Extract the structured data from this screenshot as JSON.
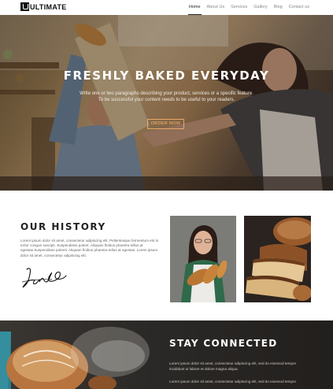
{
  "header": {
    "logo_text": "ULTIMATE",
    "nav": [
      {
        "label": "Home",
        "active": true
      },
      {
        "label": "About Us",
        "active": false
      },
      {
        "label": "Services",
        "active": false
      },
      {
        "label": "Gallery",
        "active": false
      },
      {
        "label": "Blog",
        "active": false
      },
      {
        "label": "Contact us",
        "active": false
      }
    ]
  },
  "hero": {
    "title": "FRESHLY BAKED EVERYDAY",
    "subtitle_line1": "Write one or two paragraphs describing your product, services or a specific feature.",
    "subtitle_line2": "To be successful your content needs to be useful to your readers.",
    "button_label": "ORDER NOW"
  },
  "history": {
    "title": "OUR HISTORY",
    "paragraph": "Lorem ipsum dolor sit amet, consectetur adipiscing elit. Pellentesque fermentum est in tortor congue suscipit. Suspendisse potent. Aliquam finibus pharetra tellus at egestas.Suspendisse potenti. Aliquam finibus pharetra tellus at egestas. Lorem ipsum dolor sit amet, consectetur adipiscing elit."
  },
  "connect": {
    "title": "STAY CONNECTED",
    "text1_line1": "Lorem ipsum dolor sit amet, consectetur adipiscing elit, sed do eiusmod tempor",
    "text1_line2": "incididunt ut labore et dolore magna aliqua.",
    "text2_line1": "Lorem ipsum dolor sit amet, consectetur adipiscing elit, sed do eiusmod tempor"
  },
  "colors": {
    "accent": "#e6a86a",
    "dark_section": "#2b2927"
  }
}
